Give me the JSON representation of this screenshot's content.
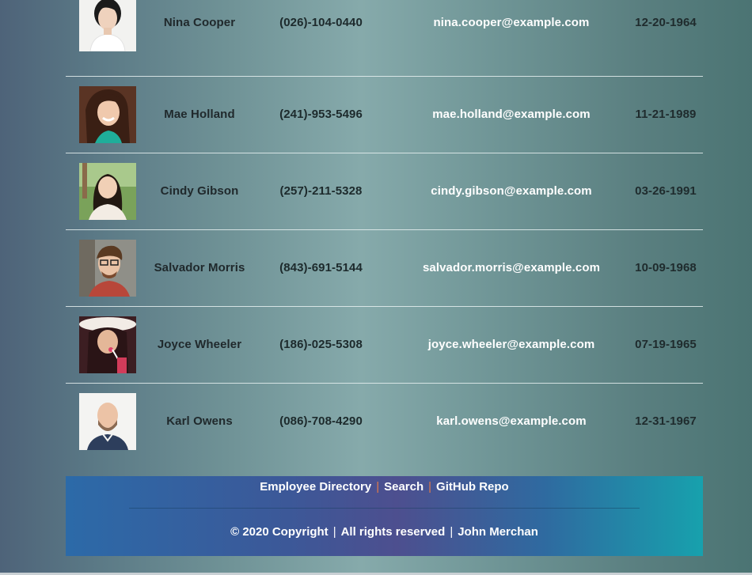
{
  "employees": [
    {
      "name": "Nina Cooper",
      "phone": "(026)-104-0440",
      "email": "nina.cooper@example.com",
      "dob": "12-20-1964",
      "avatar": "portrait-woman-short-dark-hair"
    },
    {
      "name": "Mae Holland",
      "phone": "(241)-953-5496",
      "email": "mae.holland@example.com",
      "dob": "11-21-1989",
      "avatar": "portrait-woman-long-brown-hair"
    },
    {
      "name": "Cindy Gibson",
      "phone": "(257)-211-5328",
      "email": "cindy.gibson@example.com",
      "dob": "03-26-1991",
      "avatar": "portrait-woman-outdoor"
    },
    {
      "name": "Salvador Morris",
      "phone": "(843)-691-5144",
      "email": "salvador.morris@example.com",
      "dob": "10-09-1968",
      "avatar": "portrait-man-glasses"
    },
    {
      "name": "Joyce Wheeler",
      "phone": "(186)-025-5308",
      "email": "joyce.wheeler@example.com",
      "dob": "07-19-1965",
      "avatar": "portrait-woman-hat"
    },
    {
      "name": "Karl Owens",
      "phone": "(086)-708-4290",
      "email": "karl.owens@example.com",
      "dob": "12-31-1967",
      "avatar": "portrait-man-bald-beard"
    }
  ],
  "footer": {
    "links": [
      "Employee Directory",
      "Search",
      "GitHub Repo"
    ],
    "separator": "|",
    "copyright": "© 2020 Copyright",
    "rights": "All rights reserved",
    "author": "John Merchan"
  },
  "colors": {
    "separator": "#e07a4a",
    "footer_left": "#2c6aa8",
    "footer_right": "#17a1ad",
    "email_text": "#ffffff"
  }
}
